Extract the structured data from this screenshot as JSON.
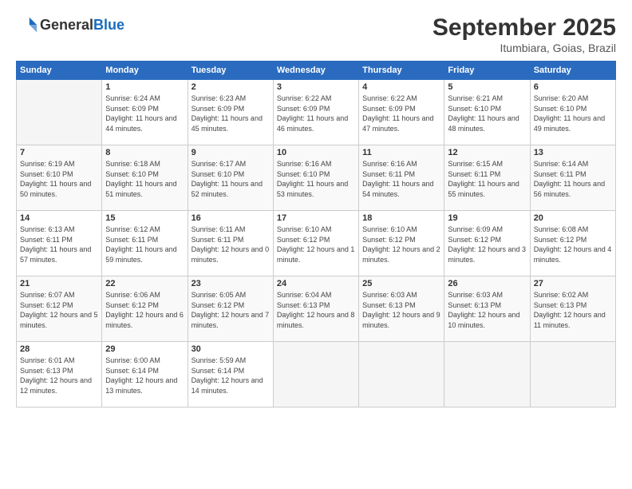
{
  "header": {
    "logo_general": "General",
    "logo_blue": "Blue",
    "month_title": "September 2025",
    "location": "Itumbiara, Goias, Brazil"
  },
  "days_of_week": [
    "Sunday",
    "Monday",
    "Tuesday",
    "Wednesday",
    "Thursday",
    "Friday",
    "Saturday"
  ],
  "weeks": [
    [
      {
        "day": "",
        "empty": true
      },
      {
        "day": "1",
        "sunrise": "6:24 AM",
        "sunset": "6:09 PM",
        "daylight": "11 hours and 44 minutes."
      },
      {
        "day": "2",
        "sunrise": "6:23 AM",
        "sunset": "6:09 PM",
        "daylight": "11 hours and 45 minutes."
      },
      {
        "day": "3",
        "sunrise": "6:22 AM",
        "sunset": "6:09 PM",
        "daylight": "11 hours and 46 minutes."
      },
      {
        "day": "4",
        "sunrise": "6:22 AM",
        "sunset": "6:09 PM",
        "daylight": "11 hours and 47 minutes."
      },
      {
        "day": "5",
        "sunrise": "6:21 AM",
        "sunset": "6:10 PM",
        "daylight": "11 hours and 48 minutes."
      },
      {
        "day": "6",
        "sunrise": "6:20 AM",
        "sunset": "6:10 PM",
        "daylight": "11 hours and 49 minutes."
      }
    ],
    [
      {
        "day": "7",
        "sunrise": "6:19 AM",
        "sunset": "6:10 PM",
        "daylight": "11 hours and 50 minutes."
      },
      {
        "day": "8",
        "sunrise": "6:18 AM",
        "sunset": "6:10 PM",
        "daylight": "11 hours and 51 minutes."
      },
      {
        "day": "9",
        "sunrise": "6:17 AM",
        "sunset": "6:10 PM",
        "daylight": "11 hours and 52 minutes."
      },
      {
        "day": "10",
        "sunrise": "6:16 AM",
        "sunset": "6:10 PM",
        "daylight": "11 hours and 53 minutes."
      },
      {
        "day": "11",
        "sunrise": "6:16 AM",
        "sunset": "6:11 PM",
        "daylight": "11 hours and 54 minutes."
      },
      {
        "day": "12",
        "sunrise": "6:15 AM",
        "sunset": "6:11 PM",
        "daylight": "11 hours and 55 minutes."
      },
      {
        "day": "13",
        "sunrise": "6:14 AM",
        "sunset": "6:11 PM",
        "daylight": "11 hours and 56 minutes."
      }
    ],
    [
      {
        "day": "14",
        "sunrise": "6:13 AM",
        "sunset": "6:11 PM",
        "daylight": "11 hours and 57 minutes."
      },
      {
        "day": "15",
        "sunrise": "6:12 AM",
        "sunset": "6:11 PM",
        "daylight": "11 hours and 59 minutes."
      },
      {
        "day": "16",
        "sunrise": "6:11 AM",
        "sunset": "6:11 PM",
        "daylight": "12 hours and 0 minutes."
      },
      {
        "day": "17",
        "sunrise": "6:10 AM",
        "sunset": "6:12 PM",
        "daylight": "12 hours and 1 minute."
      },
      {
        "day": "18",
        "sunrise": "6:10 AM",
        "sunset": "6:12 PM",
        "daylight": "12 hours and 2 minutes."
      },
      {
        "day": "19",
        "sunrise": "6:09 AM",
        "sunset": "6:12 PM",
        "daylight": "12 hours and 3 minutes."
      },
      {
        "day": "20",
        "sunrise": "6:08 AM",
        "sunset": "6:12 PM",
        "daylight": "12 hours and 4 minutes."
      }
    ],
    [
      {
        "day": "21",
        "sunrise": "6:07 AM",
        "sunset": "6:12 PM",
        "daylight": "12 hours and 5 minutes."
      },
      {
        "day": "22",
        "sunrise": "6:06 AM",
        "sunset": "6:12 PM",
        "daylight": "12 hours and 6 minutes."
      },
      {
        "day": "23",
        "sunrise": "6:05 AM",
        "sunset": "6:12 PM",
        "daylight": "12 hours and 7 minutes."
      },
      {
        "day": "24",
        "sunrise": "6:04 AM",
        "sunset": "6:13 PM",
        "daylight": "12 hours and 8 minutes."
      },
      {
        "day": "25",
        "sunrise": "6:03 AM",
        "sunset": "6:13 PM",
        "daylight": "12 hours and 9 minutes."
      },
      {
        "day": "26",
        "sunrise": "6:03 AM",
        "sunset": "6:13 PM",
        "daylight": "12 hours and 10 minutes."
      },
      {
        "day": "27",
        "sunrise": "6:02 AM",
        "sunset": "6:13 PM",
        "daylight": "12 hours and 11 minutes."
      }
    ],
    [
      {
        "day": "28",
        "sunrise": "6:01 AM",
        "sunset": "6:13 PM",
        "daylight": "12 hours and 12 minutes."
      },
      {
        "day": "29",
        "sunrise": "6:00 AM",
        "sunset": "6:14 PM",
        "daylight": "12 hours and 13 minutes."
      },
      {
        "day": "30",
        "sunrise": "5:59 AM",
        "sunset": "6:14 PM",
        "daylight": "12 hours and 14 minutes."
      },
      {
        "day": "",
        "empty": true
      },
      {
        "day": "",
        "empty": true
      },
      {
        "day": "",
        "empty": true
      },
      {
        "day": "",
        "empty": true
      }
    ]
  ]
}
